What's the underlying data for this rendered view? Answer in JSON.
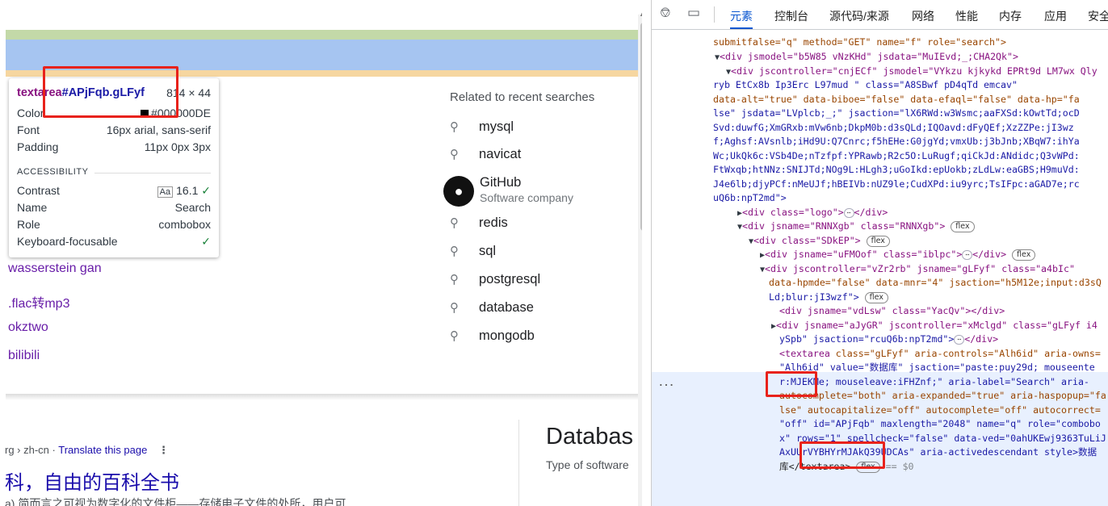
{
  "page": {
    "recent_searches": [
      "wasserstein gan",
      ".flac转mp3",
      "okztwo",
      "bilibili"
    ],
    "related_title": "Related to recent searches",
    "suggestions": [
      "mysql",
      "navicat",
      "redis",
      "sql",
      "postgresql",
      "database",
      "mongodb"
    ],
    "github": {
      "name": "GitHub",
      "subtitle": "Software company"
    },
    "result": {
      "breadcrumb": "rg › zh-cn",
      "separator": "·",
      "translate": "Translate this page",
      "title": "科，自由的百科全书",
      "snippet": "a)    简而言之可视为数字化的文件柜——存储电子文件的处所，用户可"
    },
    "knowledge_panel": {
      "title": "Databas",
      "subtitle": "Type of software"
    }
  },
  "tooltip": {
    "tag": "textarea",
    "selector": "#APjFqb.gLFyf",
    "size": "814 × 44",
    "rows": [
      {
        "key": "Color",
        "value": "#000000DE"
      },
      {
        "key": "Font",
        "value": "16px arial, sans-serif"
      },
      {
        "key": "Padding",
        "value": "11px 0px 3px"
      }
    ],
    "section": "ACCESSIBILITY",
    "a11y": [
      {
        "key": "Contrast",
        "value": "16.1"
      },
      {
        "key": "Name",
        "value": "Search"
      },
      {
        "key": "Role",
        "value": "combobox"
      },
      {
        "key": "Keyboard-focusable",
        "value": ""
      }
    ],
    "contrast_badge": "Aa"
  },
  "devtools": {
    "tabs": [
      "元素",
      "控制台",
      "源代码/来源",
      "网络",
      "性能",
      "内存",
      "应用",
      "安全"
    ],
    "active_tab": "元素",
    "lines": {
      "l0": "submitfalse=\"q\" method=\"GET\" name=\"f\" role=\"search\">",
      "l1": "<div jsmodel=\"b5W85 vNzKHd\" jsdata=\"MuIEvd;_;CHA2Qk\">",
      "l2": "<div jscontroller=\"cnjECf\" jsmodel=\"VYkzu kjkykd EPRt9d LM7wx Qly",
      "l3": "ryb EtCx8b Ip3Erc L97mud           \" class=\"A8SBwf pD4qTd emcav\"",
      "l4": "data-alt=\"true\" data-biboe=\"false\" data-efaql=\"false\" data-hp=\"fa",
      "l5": "lse\" jsdata=\"LVplcb;_;\" jsaction=\"lX6RWd:w3Wsmc;aaFXSd:kOwtTd;ocD",
      "l6": "Svd:duwfG;XmGRxb:mVw6nb;DkpM0b:d3sQLd;IQOavd:dFyQEf;XzZZPe:jI3wz",
      "l7": "f;Aghsf:AVsnlb;iHd9U:Q7Cnrc;f5hEHe:G0jgYd;vmxUb:j3bJnb;XBqW7:ihYa",
      "l8": "Wc;UkQk6c:VSb4De;nTzfpf:YPRawb;R2c5O:LuRugf;qiCkJd:ANdidc;Q3vWPd:",
      "l9": "FtWxqb;htNNz:SNIJTd;NOg9L:HLgh3;uGoIkd:epUokb;zLdLw:eaGBS;H9muVd:",
      "l10": "J4e6lb;djyPCf:nMeUJf;hBEIVb:nUZ9le;CudXPd:iu9yrc;TsIFpc:aGAD7e;rc",
      "l11": "uQ6b:npT2md\">",
      "l12": "<div class=\"logo\">",
      "l12b": "</div>",
      "l13": "<div jsname=\"RNNXgb\" class=\"RNNXgb\">",
      "l14": "<div class=\"SDkEP\">",
      "l15": "<div jsname=\"uFMOof\" class=\"iblpc\">",
      "l15b": "</div>",
      "l16": "<div jscontroller=\"vZr2rb\" jsname=\"gLFyf\" class=\"a4bIc\"",
      "l17": "data-hpmde=\"false\" data-mnr=\"4\" jsaction=\"h5M12e;input:d3sQ",
      "l18": "Ld;blur:jI3wzf\">",
      "l19": "<div jsname=\"vdLsw\" class=\"YacQv\"></div>",
      "l20": "<div jsname=\"aJyGR\" jscontroller=\"xMclgd\" class=\"gLFyf i4",
      "l21": "ySpb\" jsaction=\"rcuQ6b:npT2md\">",
      "l21b": "</div>",
      "l22a": "<textarea",
      "l22b": " class=\"gLFyf\" aria-controls=\"Alh6id\" aria-owns=",
      "l23": "\"Alh6id\" value=\"数据库\" jsaction=\"paste:puy29d; mouseente",
      "l24": "r:MJEKMe; mouseleave:iFHZnf;\" aria-label=\"Search\" aria-",
      "l25": "autocomplete=\"both\" aria-expanded=\"true\" aria-haspopup=\"fa",
      "l26": "lse\" autocapitalize=\"off\" autocomplete=\"off\" autocorrect=",
      "l27": "\"off\" id=\"APjFqb\" maxlength=\"2048\" name=\"q\" role=\"combobo",
      "l28": "x\" rows=\"1\" spellcheck=\"false\" data-ved=\"0ahUKEwj9363TuLiJ",
      "l29": "AxUUrVYBHYrMJAkQ39UDCAs\" aria-activedescendant style>数据",
      "l30a": "库</textarea>",
      "l30b": "== $0",
      "flex": "flex",
      "ellipsis": "⋯",
      "gutter": "..."
    }
  }
}
